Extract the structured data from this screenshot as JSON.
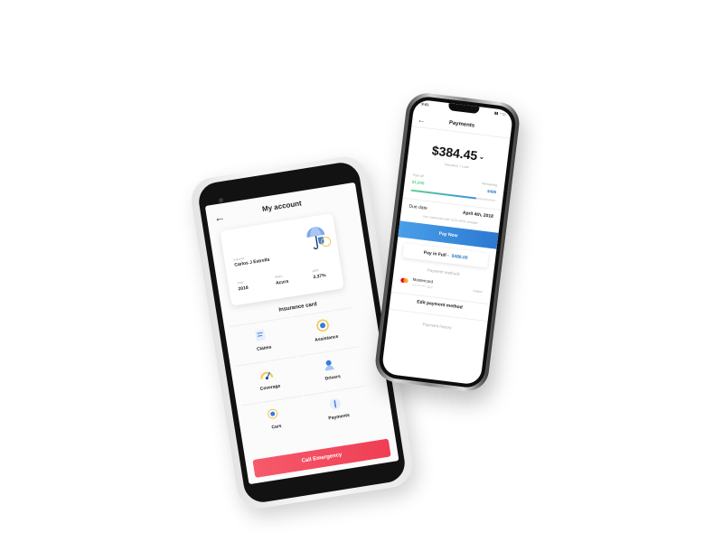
{
  "android": {
    "header": {
      "back_icon": "arrow-left-icon",
      "title": "My account"
    },
    "card": {
      "name_label": "Insured",
      "name": "Carlos J Estrella",
      "columns": [
        {
          "label": "Year",
          "value": "2018"
        },
        {
          "label": "Make",
          "value": "Acura"
        },
        {
          "label": "APR",
          "value": "3.37%"
        }
      ],
      "illustration_icon": "umbrella-shield-icon"
    },
    "section_title": "Insurance card",
    "tiles": [
      {
        "label": "Claims",
        "icon": "claims-icon"
      },
      {
        "label": "Assistance",
        "icon": "assistance-icon"
      },
      {
        "label": "Coverage",
        "icon": "coverage-icon"
      },
      {
        "label": "Drivers",
        "icon": "drivers-icon"
      },
      {
        "label": "Cars",
        "icon": "cars-icon"
      },
      {
        "label": "Payments",
        "icon": "payments-icon"
      }
    ],
    "emergency_button": "Call Emergency",
    "colors": {
      "emergency": "#ef3e54"
    }
  },
  "iphone": {
    "status": {
      "time": "9:41",
      "icons": "▮▮ ◔ ▭"
    },
    "header": {
      "back_icon": "arrow-left-icon",
      "title": "Payments"
    },
    "amount": "$384.45",
    "amount_sub": "Insurance + Loan",
    "paid_off": {
      "label": "Paid off",
      "value": "$1,846"
    },
    "remaining": {
      "label": "Remaining",
      "value": "$486"
    },
    "progress_fraction": 0.78,
    "due": {
      "label": "Due date",
      "value": "April 4th, 2018"
    },
    "due_note": "Your mastercard with *1122 will be charged",
    "pay_now": "Pay Now",
    "pay_full": {
      "label": "Pay in Full -",
      "amount": "$486.00"
    },
    "payment_methods_title": "Payment methods",
    "card": {
      "name": "Mastercard",
      "number": "**** **** **** 1122",
      "tag": "Default"
    },
    "edit_payment": "Edit payment method",
    "payment_history_title": "Payment history",
    "colors": {
      "accent": "#2b79d1",
      "paid": "#5fd38d"
    }
  }
}
